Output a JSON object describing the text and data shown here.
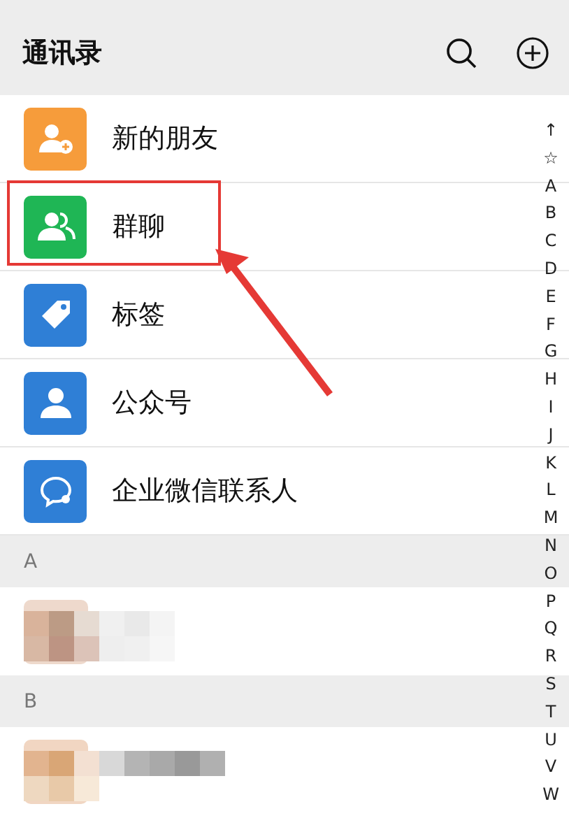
{
  "header": {
    "title": "通讯录"
  },
  "entries": [
    {
      "label": "新的朋友",
      "kind": "new-friends",
      "color": "#f69c3b"
    },
    {
      "label": "群聊",
      "kind": "group-chat",
      "color": "#1fb655"
    },
    {
      "label": "标签",
      "kind": "tag",
      "color": "#2f7fd6"
    },
    {
      "label": "公众号",
      "kind": "official",
      "color": "#2f7fd6"
    },
    {
      "label": "企业微信联系人",
      "kind": "work",
      "color": "#2f7fd6"
    }
  ],
  "sections": [
    {
      "letter": "A"
    },
    {
      "letter": "B"
    }
  ],
  "index": [
    "↑",
    "☆",
    "A",
    "B",
    "C",
    "D",
    "E",
    "F",
    "G",
    "H",
    "I",
    "J",
    "K",
    "L",
    "M",
    "N",
    "O",
    "P",
    "Q",
    "R",
    "S",
    "T",
    "U",
    "V",
    "W"
  ]
}
